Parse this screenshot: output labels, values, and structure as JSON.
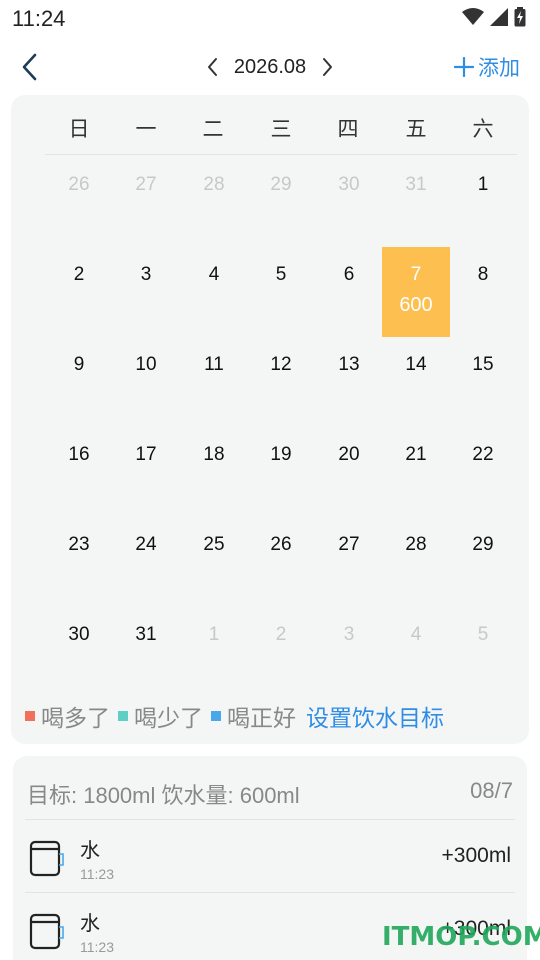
{
  "status_bar": {
    "time": "11:24",
    "icons": [
      "wifi-icon",
      "signal-icon",
      "battery-charging-icon"
    ]
  },
  "header": {
    "back_icon": "chevron-left-icon",
    "prev_icon": "chevron-left-icon",
    "next_icon": "chevron-right-icon",
    "month": "2026.08",
    "add_label": "添加"
  },
  "calendar": {
    "weekdays": [
      "日",
      "一",
      "二",
      "三",
      "四",
      "五",
      "六"
    ],
    "weeks": [
      [
        {
          "d": "26",
          "out": true
        },
        {
          "d": "27",
          "out": true
        },
        {
          "d": "28",
          "out": true
        },
        {
          "d": "29",
          "out": true
        },
        {
          "d": "30",
          "out": true
        },
        {
          "d": "31",
          "out": true
        },
        {
          "d": "1"
        }
      ],
      [
        {
          "d": "2"
        },
        {
          "d": "3"
        },
        {
          "d": "4"
        },
        {
          "d": "5"
        },
        {
          "d": "6"
        },
        {
          "d": "7",
          "selected": true,
          "amount": "600"
        },
        {
          "d": "8"
        }
      ],
      [
        {
          "d": "9"
        },
        {
          "d": "10"
        },
        {
          "d": "11"
        },
        {
          "d": "12"
        },
        {
          "d": "13"
        },
        {
          "d": "14"
        },
        {
          "d": "15"
        }
      ],
      [
        {
          "d": "16"
        },
        {
          "d": "17"
        },
        {
          "d": "18"
        },
        {
          "d": "19"
        },
        {
          "d": "20"
        },
        {
          "d": "21"
        },
        {
          "d": "22"
        }
      ],
      [
        {
          "d": "23"
        },
        {
          "d": "24"
        },
        {
          "d": "25"
        },
        {
          "d": "26"
        },
        {
          "d": "27"
        },
        {
          "d": "28"
        },
        {
          "d": "29"
        }
      ],
      [
        {
          "d": "30"
        },
        {
          "d": "31"
        },
        {
          "d": "1",
          "out": true
        },
        {
          "d": "2",
          "out": true
        },
        {
          "d": "3",
          "out": true
        },
        {
          "d": "4",
          "out": true
        },
        {
          "d": "5",
          "out": true
        }
      ]
    ],
    "selected_color": "#fdbf50"
  },
  "legend": {
    "items": [
      {
        "label": "喝多了",
        "color": "#f2705b"
      },
      {
        "label": "喝少了",
        "color": "#5ecfc4"
      },
      {
        "label": "喝正好",
        "color": "#4aa7ea"
      }
    ],
    "goal_link": "设置饮水目标"
  },
  "records": {
    "summary": "目标: 1800ml 饮水量: 600ml",
    "date": "08/7",
    "items": [
      {
        "icon": "cup-icon",
        "name": "水",
        "time": "11:23",
        "amount": "+300ml"
      },
      {
        "icon": "cup-icon",
        "name": "水",
        "time": "11:23",
        "amount": "+300ml"
      }
    ]
  },
  "watermark": "ITMOP.COM",
  "colors": {
    "accent": "#2f8de4",
    "card_bg": "#f4f6f6"
  }
}
